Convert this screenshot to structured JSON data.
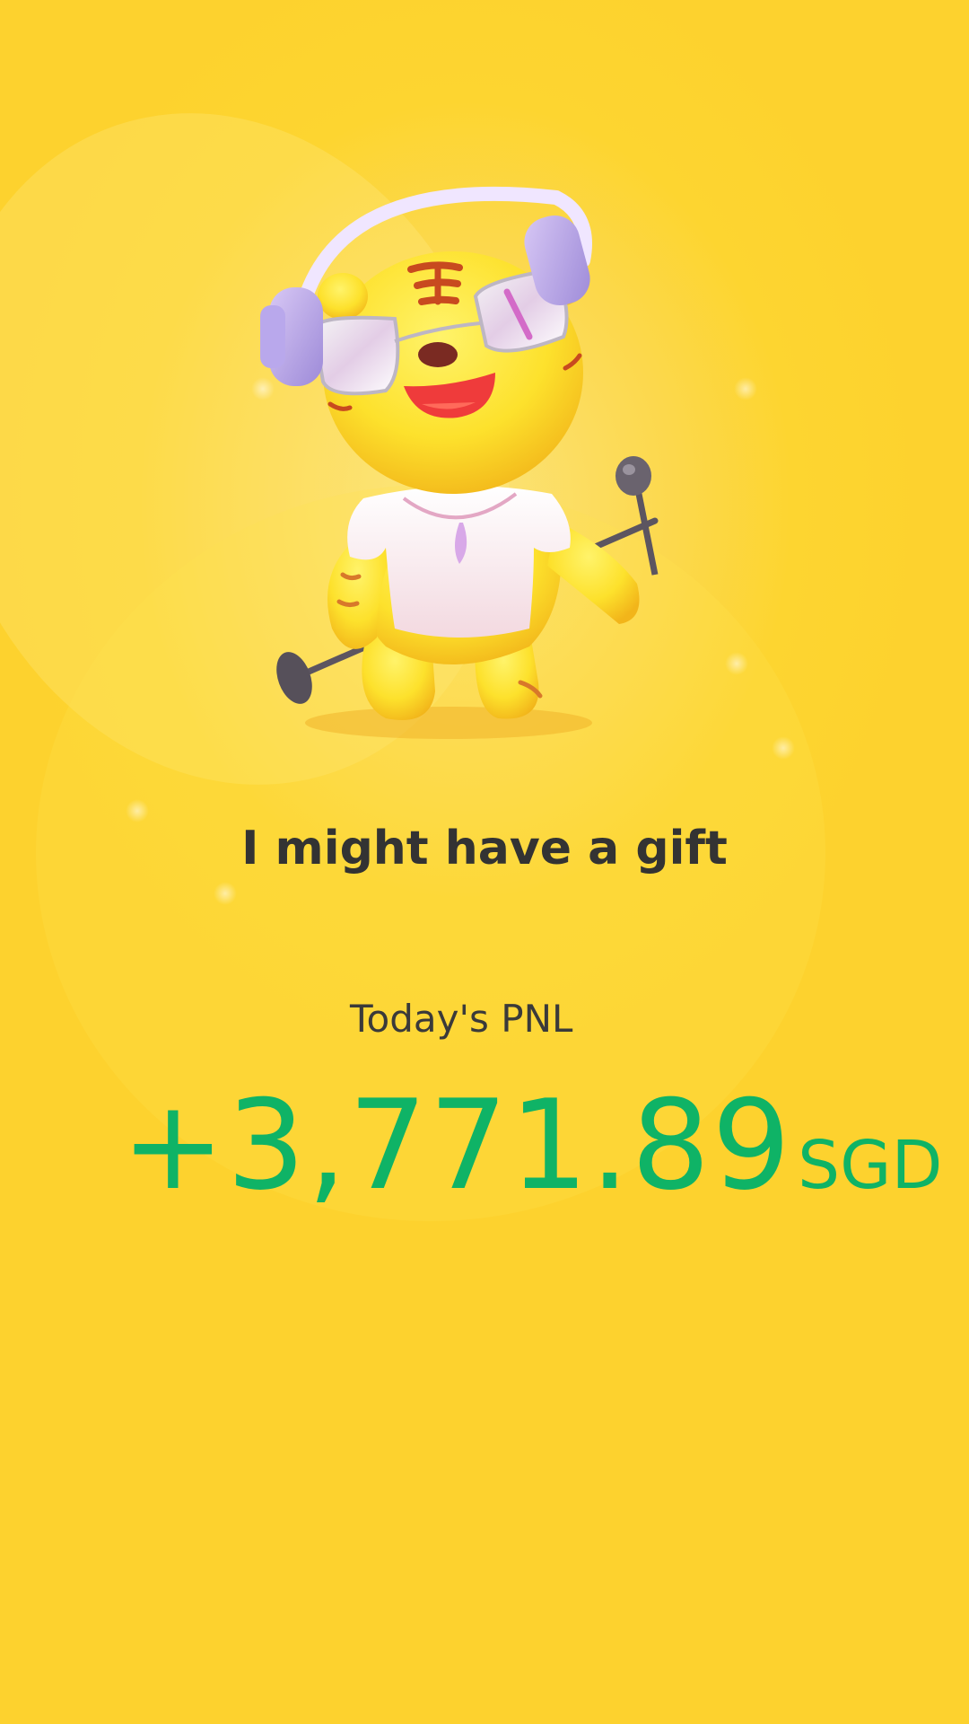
{
  "screen": {
    "background_color": "#fdd22e",
    "accent_color": "#0fb366"
  },
  "mascot": {
    "icon": "tiger-mascot-singing-with-microphone"
  },
  "headline": "I might have a gift",
  "pnl": {
    "label": "Today's PNL",
    "amount": "+3,771.89",
    "currency": "SGD"
  }
}
